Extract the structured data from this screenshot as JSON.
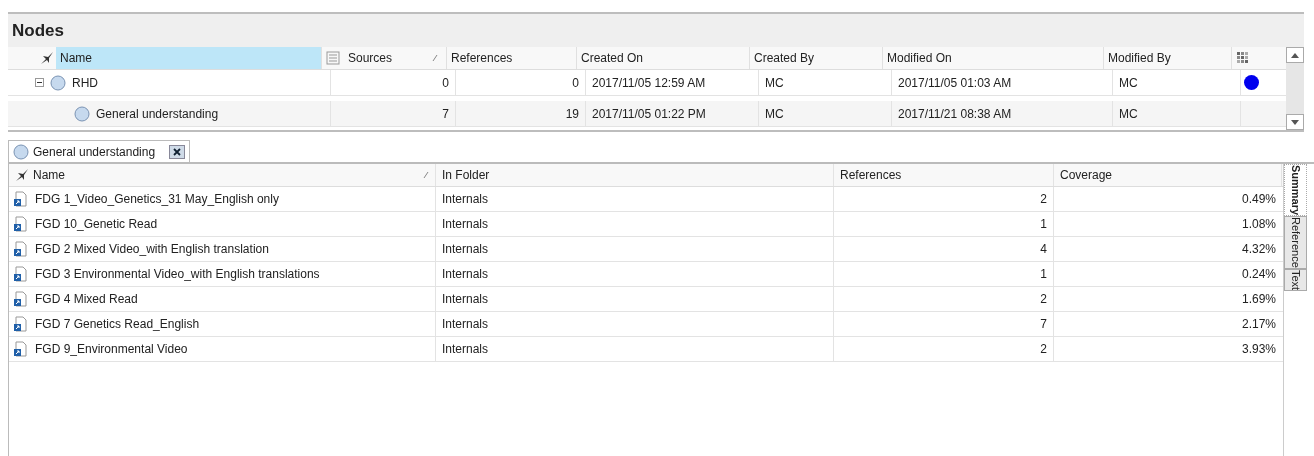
{
  "nodes_panel": {
    "title": "Nodes",
    "columns": [
      {
        "label": "Name",
        "selected": true,
        "sorted": false
      },
      {
        "label": "Sources",
        "selected": false,
        "sorted": true
      },
      {
        "label": "References",
        "selected": false,
        "sorted": false
      },
      {
        "label": "Created On",
        "selected": false,
        "sorted": false
      },
      {
        "label": "Created By",
        "selected": false,
        "sorted": false
      },
      {
        "label": "Modified On",
        "selected": false,
        "sorted": false
      },
      {
        "label": "Modified By",
        "selected": false,
        "sorted": false
      }
    ],
    "rows": [
      {
        "name": "RHD",
        "expanded": true,
        "sources": "0",
        "references": "0",
        "created_on": "2017/11/05 12:59 AM",
        "created_by": "MC",
        "modified_on": "2017/11/05 01:03 AM",
        "modified_by": "MC",
        "color": "#0000ee",
        "children": [
          {
            "name": "General understanding",
            "sources": "7",
            "references": "19",
            "created_on": "2017/11/05 01:22 PM",
            "created_by": "MC",
            "modified_on": "2017/11/21 08:38 AM",
            "modified_by": "MC"
          }
        ]
      }
    ]
  },
  "detail": {
    "tab": {
      "label": "General understanding"
    },
    "columns": [
      {
        "label": "Name",
        "sorted": true
      },
      {
        "label": "In Folder",
        "sorted": false
      },
      {
        "label": "References",
        "sorted": false
      },
      {
        "label": "Coverage",
        "sorted": false
      }
    ],
    "rows": [
      {
        "name": "FDG 1_Video_Genetics_31 May_English only",
        "folder": "Internals",
        "references": "2",
        "coverage": "0.49%"
      },
      {
        "name": "FGD 10_Genetic Read",
        "folder": "Internals",
        "references": "1",
        "coverage": "1.08%"
      },
      {
        "name": "FGD 2 Mixed Video_with English translation",
        "folder": "Internals",
        "references": "4",
        "coverage": "4.32%"
      },
      {
        "name": "FGD 3 Environmental Video_with English translations",
        "folder": "Internals",
        "references": "1",
        "coverage": "0.24%"
      },
      {
        "name": "FGD 4 Mixed Read",
        "folder": "Internals",
        "references": "2",
        "coverage": "1.69%"
      },
      {
        "name": "FGD 7 Genetics Read_English",
        "folder": "Internals",
        "references": "7",
        "coverage": "2.17%"
      },
      {
        "name": "FGD 9_Environmental Video",
        "folder": "Internals",
        "references": "2",
        "coverage": "3.93%"
      }
    ],
    "side_tabs": [
      {
        "label": "Summary",
        "selected": true
      },
      {
        "label": "Reference",
        "selected": false
      },
      {
        "label": "Text",
        "selected": false
      }
    ]
  }
}
